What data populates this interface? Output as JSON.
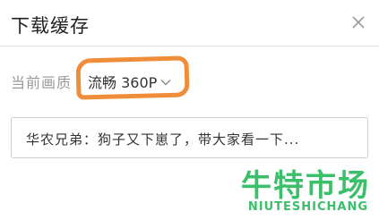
{
  "dialog": {
    "title": "下载缓存",
    "close_icon": "close-icon"
  },
  "quality": {
    "label": "当前画质",
    "selected": "流畅 360P",
    "dropdown_icon": "chevron-down-icon",
    "highlight_color": "#f08d3b"
  },
  "item": {
    "text": "华农兄弟：狗子又下崽了，带大家看一下..."
  },
  "watermark": {
    "text": "牛特市场",
    "subtext": "NIUTESHICHANG",
    "color": "#3cbf6a"
  }
}
